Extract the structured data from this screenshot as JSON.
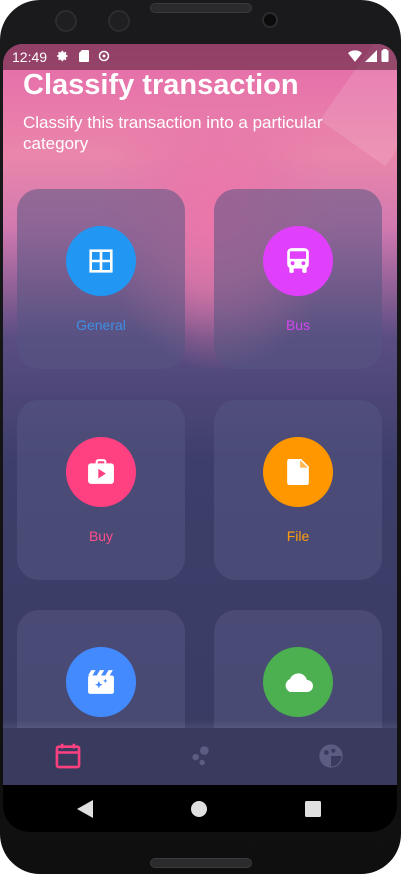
{
  "status_bar": {
    "time": "12:49"
  },
  "header": {
    "title": "Classify transaction",
    "subtitle": "Classify this transaction into a particular category"
  },
  "categories": [
    {
      "label": "General",
      "icon": "grid-icon",
      "color": "#2196F3",
      "label_color": "#3d8fe6"
    },
    {
      "label": "Bus",
      "icon": "bus-icon",
      "color": "#E040FB",
      "label_color": "#d646f0"
    },
    {
      "label": "Buy",
      "icon": "shopping-bag-icon",
      "color": "#FF4081",
      "label_color": "#ff4d8a"
    },
    {
      "label": "File",
      "icon": "file-icon",
      "color": "#FF9800",
      "label_color": "#ff9d10"
    },
    {
      "label": "",
      "icon": "movie-clapper-icon",
      "color": "#448AFF",
      "label_color": "#448AFF"
    },
    {
      "label": "",
      "icon": "cloud-icon",
      "color": "#4CAF50",
      "label_color": "#4CAF50"
    }
  ],
  "bottom_nav": {
    "items": [
      {
        "icon": "calendar-icon",
        "active": true
      },
      {
        "icon": "bubbles-icon",
        "active": false
      },
      {
        "icon": "palette-icon",
        "active": false
      }
    ]
  },
  "colors": {
    "accent": "#FF4081",
    "nav_background": "#3a3a5e"
  }
}
